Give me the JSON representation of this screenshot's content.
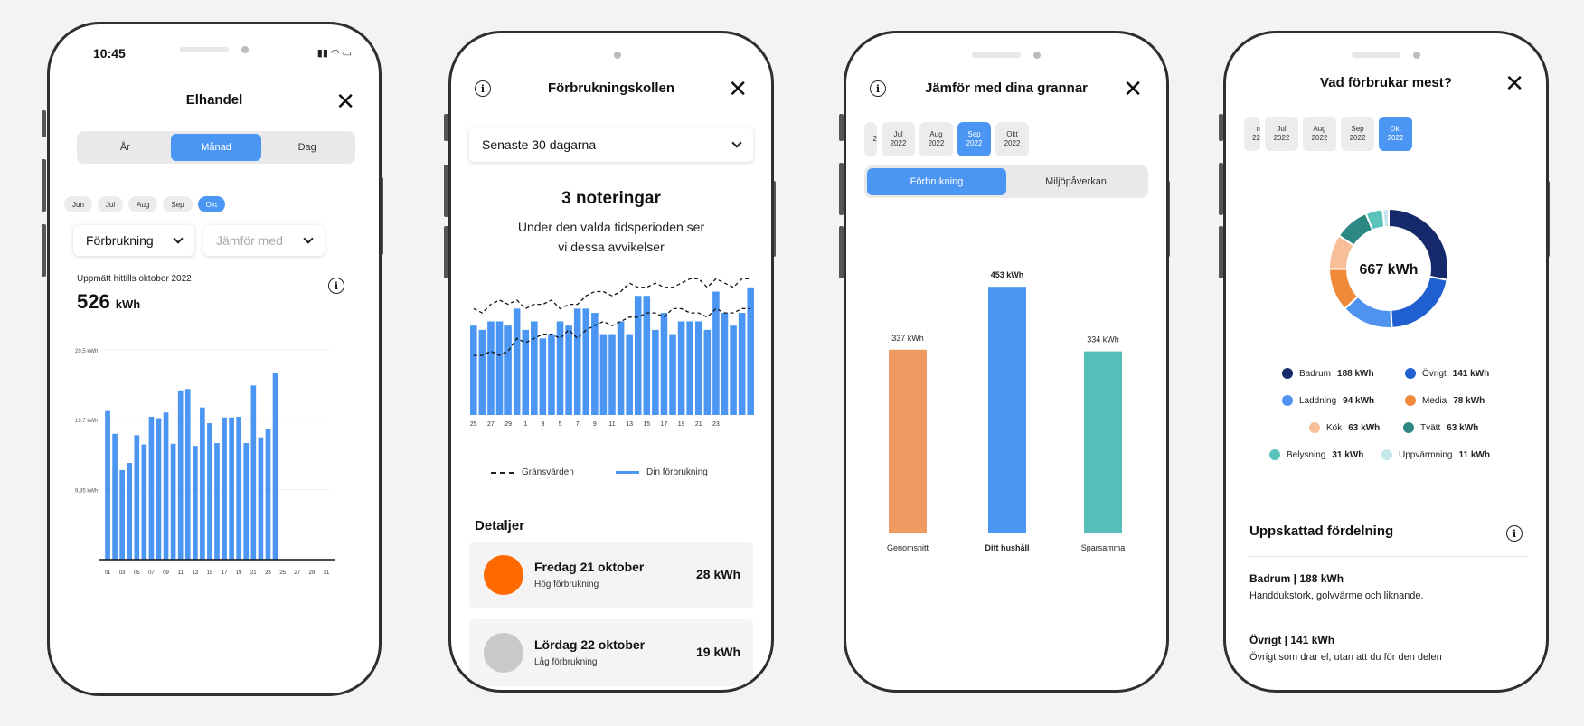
{
  "colors": {
    "accent": "#4a96f2",
    "orange": "#ee9a60",
    "teal": "#57bfba"
  },
  "phone1": {
    "status_time": "10:45",
    "title": "Elhandel",
    "tabs": [
      {
        "label": "År",
        "active": false
      },
      {
        "label": "Månad",
        "active": true
      },
      {
        "label": "Dag",
        "active": false
      }
    ],
    "months": [
      {
        "label": "Jun",
        "active": false
      },
      {
        "label": "Jul",
        "active": false
      },
      {
        "label": "Aug",
        "active": false
      },
      {
        "label": "Sep",
        "active": false
      },
      {
        "label": "Okt",
        "active": true
      }
    ],
    "dropdown_value": "Förbrukning",
    "compare_placeholder": "Jämför med",
    "measured_label": "Uppmätt hittills oktober 2022",
    "measured_value": "526",
    "measured_unit": "kWh"
  },
  "phone2": {
    "title": "Förbrukningskollen",
    "period": "Senaste 30 dagarna",
    "headline": "3 noteringar",
    "subtext_line1": "Under den valda tidsperioden ser",
    "subtext_line2": "vi dessa avvikelser",
    "legend_limits": "Gränsvärden",
    "legend_usage": "Din förbrukning",
    "details_title": "Detaljer",
    "details": [
      {
        "date": "Fredag 21 oktober",
        "note": "Hög förbrukning",
        "value": "28 kWh",
        "color": "#ff6a00"
      },
      {
        "date": "Lördag 22 oktober",
        "note": "Låg förbrukning",
        "value": "19 kWh",
        "color": "#c9c9c9"
      }
    ]
  },
  "phone3": {
    "title": "Jämför med dina grannar",
    "months": [
      {
        "m": "",
        "y": "2"
      },
      {
        "m": "Jul",
        "y": "2022"
      },
      {
        "m": "Aug",
        "y": "2022"
      },
      {
        "m": "Sep",
        "y": "2022",
        "active": true
      },
      {
        "m": "Okt",
        "y": "2022"
      }
    ],
    "tabs": [
      {
        "label": "Förbrukning",
        "active": true
      },
      {
        "label": "Miljöpåverkan",
        "active": false
      }
    ]
  },
  "phone4": {
    "title": "Vad förbrukar mest?",
    "months": [
      {
        "m": "n",
        "y": "22"
      },
      {
        "m": "Jul",
        "y": "2022"
      },
      {
        "m": "Aug",
        "y": "2022"
      },
      {
        "m": "Sep",
        "y": "2022"
      },
      {
        "m": "Okt",
        "y": "2022",
        "active": true
      }
    ],
    "total": "667 kWh",
    "section_title": "Uppskattad fördelning",
    "items": [
      {
        "title": "Badrum | 188 kWh",
        "desc": "Handdukstork, golvvärme och liknande."
      },
      {
        "title": "Övrigt | 141 kWh",
        "desc": "Övrigt som drar el, utan att du för den delen"
      }
    ]
  },
  "chart_data": [
    {
      "type": "bar",
      "title": "",
      "x": [
        "01",
        "02",
        "03",
        "04",
        "05",
        "06",
        "07",
        "08",
        "09",
        "10",
        "11",
        "12",
        "13",
        "14",
        "15",
        "16",
        "17",
        "18",
        "19",
        "20",
        "21",
        "22",
        "23",
        "24",
        "25"
      ],
      "x_tick_labels": [
        "01",
        "03",
        "05",
        "07",
        "09",
        "11",
        "13",
        "15",
        "17",
        "19",
        "21",
        "23",
        "25",
        "27",
        "29",
        "31"
      ],
      "values": [
        20.9,
        17.7,
        12.6,
        13.6,
        17.5,
        16.2,
        20.1,
        19.9,
        20.7,
        16.3,
        23.8,
        24.0,
        16.0,
        21.4,
        19.2,
        16.4,
        20.0,
        20.0,
        20.1,
        16.4,
        24.5,
        17.2,
        18.4,
        26.2
      ],
      "y_tick_labels": [
        "9,85 kWh",
        "19,7 kWh",
        "29,5 kWh"
      ],
      "ylim": [
        0,
        29.5
      ]
    },
    {
      "type": "line",
      "title": "",
      "x_tick_labels": [
        "25",
        "27",
        "29",
        "1",
        "3",
        "5",
        "7",
        "9",
        "11",
        "13",
        "15",
        "17",
        "19",
        "21",
        "23"
      ],
      "series": [
        {
          "name": "Din förbrukning",
          "values": [
            21,
            20,
            22,
            22,
            21,
            25,
            20,
            22,
            18,
            19,
            22,
            21,
            25,
            25,
            24,
            19,
            19,
            22,
            19,
            28,
            28,
            20,
            24,
            19,
            22,
            22,
            22,
            20,
            29,
            24,
            21,
            24,
            30
          ],
          "style": "bar"
        },
        {
          "name": "Gränsvärden",
          "values": [
            25,
            24,
            26,
            27,
            26,
            27,
            25,
            26,
            26,
            27,
            25,
            26,
            26,
            28,
            29,
            29,
            28,
            29,
            31,
            30,
            30,
            31,
            30,
            30,
            31,
            32,
            32,
            30,
            32,
            31,
            30,
            32,
            32
          ],
          "style": "dashed"
        },
        {
          "name": "Gränsvärden",
          "values": [
            14,
            14,
            15,
            14,
            15,
            18,
            17,
            18,
            19,
            19,
            18,
            20,
            18,
            20,
            21,
            22,
            21,
            22,
            23,
            23,
            24,
            24,
            23,
            25,
            25,
            24,
            24,
            23,
            25,
            24,
            24,
            25,
            25
          ],
          "style": "dashed"
        }
      ]
    },
    {
      "type": "bar",
      "title": "",
      "categories": [
        "Genomsnitt",
        "Ditt hushåll",
        "Sparsamma"
      ],
      "values": [
        337,
        453,
        334
      ],
      "data_labels": [
        "337 kWh",
        "453 kWh",
        "334 kWh"
      ],
      "colors": [
        "#ee9a60",
        "#4a96f2",
        "#57bfba"
      ]
    },
    {
      "type": "pie",
      "title": "",
      "categories": [
        "Badrum",
        "Övrigt",
        "Laddning",
        "Media",
        "Kök",
        "Tvätt",
        "Belysning",
        "Uppvärmning"
      ],
      "values": [
        188,
        141,
        94,
        78,
        63,
        63,
        31,
        11
      ],
      "labels": [
        "188 kWh",
        "141 kWh",
        "94 kWh",
        "78 kWh",
        "63 kWh",
        "63 kWh",
        "31 kWh",
        "11 kWh"
      ],
      "colors": [
        "#162a6b",
        "#1f5fd0",
        "#4f93ee",
        "#f08a3a",
        "#f6bf98",
        "#2d8783",
        "#5bc3bc",
        "#c5e6ea"
      ]
    }
  ]
}
